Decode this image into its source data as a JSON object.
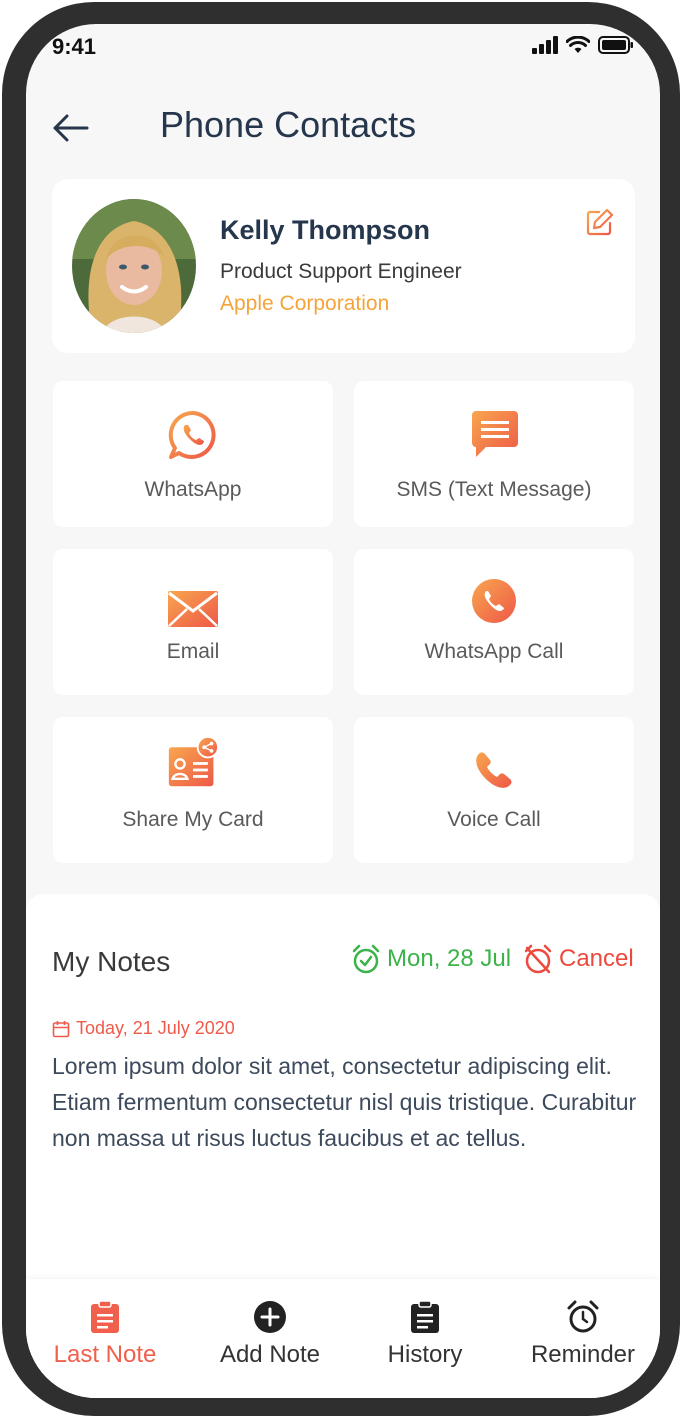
{
  "status_bar": {
    "time": "9:41"
  },
  "header": {
    "title": "Phone Contacts"
  },
  "contact": {
    "name": "Kelly Thompson",
    "role": "Product Support Engineer",
    "company": "Apple Corporation"
  },
  "actions": [
    {
      "label": "WhatsApp",
      "icon": "whatsapp-icon"
    },
    {
      "label": "SMS (Text Message)",
      "icon": "message-icon"
    },
    {
      "label": "Email",
      "icon": "mail-icon"
    },
    {
      "label": "WhatsApp Call",
      "icon": "phone-circle-icon"
    },
    {
      "label": "Share My Card",
      "icon": "contact-card-share-icon"
    },
    {
      "label": "Voice Call",
      "icon": "phone-icon"
    }
  ],
  "notes": {
    "title": "My Notes",
    "reminder_date": "Mon, 28 Jul",
    "cancel_label": "Cancel",
    "note_date": "Today, 21 July 2020",
    "note_body": "Lorem ipsum dolor sit amet, consectetur adipiscing elit. Etiam fermentum consectetur nisl quis tristique. Curabitur non massa ut risus luctus faucibus et ac tellus."
  },
  "bottom_nav": [
    {
      "label": "Last Note",
      "icon": "clipboard-icon",
      "active": true
    },
    {
      "label": "Add Note",
      "icon": "plus-circle-icon",
      "active": false
    },
    {
      "label": "History",
      "icon": "clipboard-list-icon",
      "active": false
    },
    {
      "label": "Reminder",
      "icon": "alarm-clock-icon",
      "active": false
    }
  ],
  "colors": {
    "accent_orange": "#f4a43a",
    "icon_gradient_start": "#f6a24c",
    "icon_gradient_end": "#ef5a4a",
    "reminder_green": "#3bb34a",
    "cancel_red": "#ec4a3e",
    "title_navy": "#25364d"
  }
}
